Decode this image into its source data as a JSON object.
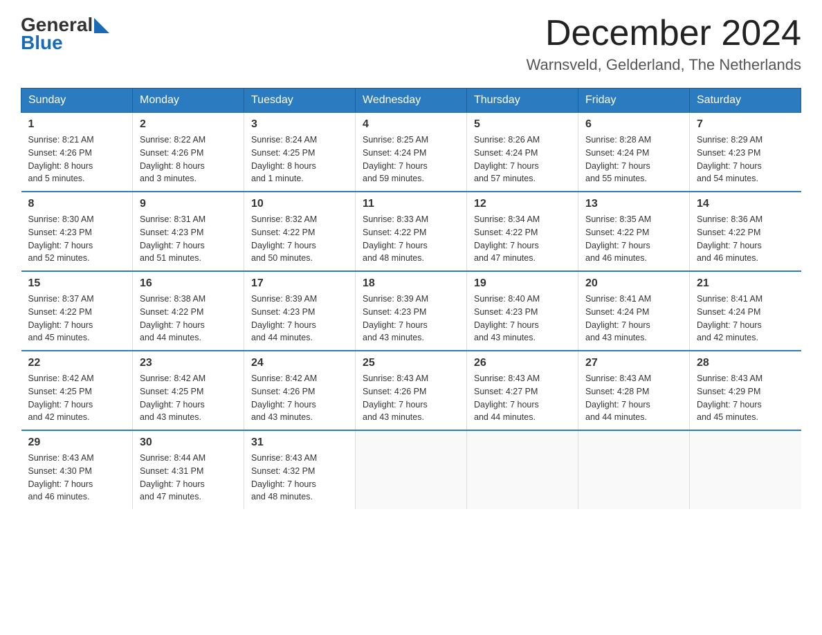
{
  "header": {
    "logo": {
      "text_general": "General",
      "text_blue": "Blue",
      "arrow_label": "arrow-icon"
    },
    "title": "December 2024",
    "location": "Warnsveld, Gelderland, The Netherlands"
  },
  "days_of_week": [
    "Sunday",
    "Monday",
    "Tuesday",
    "Wednesday",
    "Thursday",
    "Friday",
    "Saturday"
  ],
  "weeks": [
    [
      {
        "day": "1",
        "sunrise": "Sunrise: 8:21 AM",
        "sunset": "Sunset: 4:26 PM",
        "daylight": "Daylight: 8 hours",
        "daylight2": "and 5 minutes."
      },
      {
        "day": "2",
        "sunrise": "Sunrise: 8:22 AM",
        "sunset": "Sunset: 4:26 PM",
        "daylight": "Daylight: 8 hours",
        "daylight2": "and 3 minutes."
      },
      {
        "day": "3",
        "sunrise": "Sunrise: 8:24 AM",
        "sunset": "Sunset: 4:25 PM",
        "daylight": "Daylight: 8 hours",
        "daylight2": "and 1 minute."
      },
      {
        "day": "4",
        "sunrise": "Sunrise: 8:25 AM",
        "sunset": "Sunset: 4:24 PM",
        "daylight": "Daylight: 7 hours",
        "daylight2": "and 59 minutes."
      },
      {
        "day": "5",
        "sunrise": "Sunrise: 8:26 AM",
        "sunset": "Sunset: 4:24 PM",
        "daylight": "Daylight: 7 hours",
        "daylight2": "and 57 minutes."
      },
      {
        "day": "6",
        "sunrise": "Sunrise: 8:28 AM",
        "sunset": "Sunset: 4:24 PM",
        "daylight": "Daylight: 7 hours",
        "daylight2": "and 55 minutes."
      },
      {
        "day": "7",
        "sunrise": "Sunrise: 8:29 AM",
        "sunset": "Sunset: 4:23 PM",
        "daylight": "Daylight: 7 hours",
        "daylight2": "and 54 minutes."
      }
    ],
    [
      {
        "day": "8",
        "sunrise": "Sunrise: 8:30 AM",
        "sunset": "Sunset: 4:23 PM",
        "daylight": "Daylight: 7 hours",
        "daylight2": "and 52 minutes."
      },
      {
        "day": "9",
        "sunrise": "Sunrise: 8:31 AM",
        "sunset": "Sunset: 4:23 PM",
        "daylight": "Daylight: 7 hours",
        "daylight2": "and 51 minutes."
      },
      {
        "day": "10",
        "sunrise": "Sunrise: 8:32 AM",
        "sunset": "Sunset: 4:22 PM",
        "daylight": "Daylight: 7 hours",
        "daylight2": "and 50 minutes."
      },
      {
        "day": "11",
        "sunrise": "Sunrise: 8:33 AM",
        "sunset": "Sunset: 4:22 PM",
        "daylight": "Daylight: 7 hours",
        "daylight2": "and 48 minutes."
      },
      {
        "day": "12",
        "sunrise": "Sunrise: 8:34 AM",
        "sunset": "Sunset: 4:22 PM",
        "daylight": "Daylight: 7 hours",
        "daylight2": "and 47 minutes."
      },
      {
        "day": "13",
        "sunrise": "Sunrise: 8:35 AM",
        "sunset": "Sunset: 4:22 PM",
        "daylight": "Daylight: 7 hours",
        "daylight2": "and 46 minutes."
      },
      {
        "day": "14",
        "sunrise": "Sunrise: 8:36 AM",
        "sunset": "Sunset: 4:22 PM",
        "daylight": "Daylight: 7 hours",
        "daylight2": "and 46 minutes."
      }
    ],
    [
      {
        "day": "15",
        "sunrise": "Sunrise: 8:37 AM",
        "sunset": "Sunset: 4:22 PM",
        "daylight": "Daylight: 7 hours",
        "daylight2": "and 45 minutes."
      },
      {
        "day": "16",
        "sunrise": "Sunrise: 8:38 AM",
        "sunset": "Sunset: 4:22 PM",
        "daylight": "Daylight: 7 hours",
        "daylight2": "and 44 minutes."
      },
      {
        "day": "17",
        "sunrise": "Sunrise: 8:39 AM",
        "sunset": "Sunset: 4:23 PM",
        "daylight": "Daylight: 7 hours",
        "daylight2": "and 44 minutes."
      },
      {
        "day": "18",
        "sunrise": "Sunrise: 8:39 AM",
        "sunset": "Sunset: 4:23 PM",
        "daylight": "Daylight: 7 hours",
        "daylight2": "and 43 minutes."
      },
      {
        "day": "19",
        "sunrise": "Sunrise: 8:40 AM",
        "sunset": "Sunset: 4:23 PM",
        "daylight": "Daylight: 7 hours",
        "daylight2": "and 43 minutes."
      },
      {
        "day": "20",
        "sunrise": "Sunrise: 8:41 AM",
        "sunset": "Sunset: 4:24 PM",
        "daylight": "Daylight: 7 hours",
        "daylight2": "and 43 minutes."
      },
      {
        "day": "21",
        "sunrise": "Sunrise: 8:41 AM",
        "sunset": "Sunset: 4:24 PM",
        "daylight": "Daylight: 7 hours",
        "daylight2": "and 42 minutes."
      }
    ],
    [
      {
        "day": "22",
        "sunrise": "Sunrise: 8:42 AM",
        "sunset": "Sunset: 4:25 PM",
        "daylight": "Daylight: 7 hours",
        "daylight2": "and 42 minutes."
      },
      {
        "day": "23",
        "sunrise": "Sunrise: 8:42 AM",
        "sunset": "Sunset: 4:25 PM",
        "daylight": "Daylight: 7 hours",
        "daylight2": "and 43 minutes."
      },
      {
        "day": "24",
        "sunrise": "Sunrise: 8:42 AM",
        "sunset": "Sunset: 4:26 PM",
        "daylight": "Daylight: 7 hours",
        "daylight2": "and 43 minutes."
      },
      {
        "day": "25",
        "sunrise": "Sunrise: 8:43 AM",
        "sunset": "Sunset: 4:26 PM",
        "daylight": "Daylight: 7 hours",
        "daylight2": "and 43 minutes."
      },
      {
        "day": "26",
        "sunrise": "Sunrise: 8:43 AM",
        "sunset": "Sunset: 4:27 PM",
        "daylight": "Daylight: 7 hours",
        "daylight2": "and 44 minutes."
      },
      {
        "day": "27",
        "sunrise": "Sunrise: 8:43 AM",
        "sunset": "Sunset: 4:28 PM",
        "daylight": "Daylight: 7 hours",
        "daylight2": "and 44 minutes."
      },
      {
        "day": "28",
        "sunrise": "Sunrise: 8:43 AM",
        "sunset": "Sunset: 4:29 PM",
        "daylight": "Daylight: 7 hours",
        "daylight2": "and 45 minutes."
      }
    ],
    [
      {
        "day": "29",
        "sunrise": "Sunrise: 8:43 AM",
        "sunset": "Sunset: 4:30 PM",
        "daylight": "Daylight: 7 hours",
        "daylight2": "and 46 minutes."
      },
      {
        "day": "30",
        "sunrise": "Sunrise: 8:44 AM",
        "sunset": "Sunset: 4:31 PM",
        "daylight": "Daylight: 7 hours",
        "daylight2": "and 47 minutes."
      },
      {
        "day": "31",
        "sunrise": "Sunrise: 8:43 AM",
        "sunset": "Sunset: 4:32 PM",
        "daylight": "Daylight: 7 hours",
        "daylight2": "and 48 minutes."
      },
      null,
      null,
      null,
      null
    ]
  ]
}
